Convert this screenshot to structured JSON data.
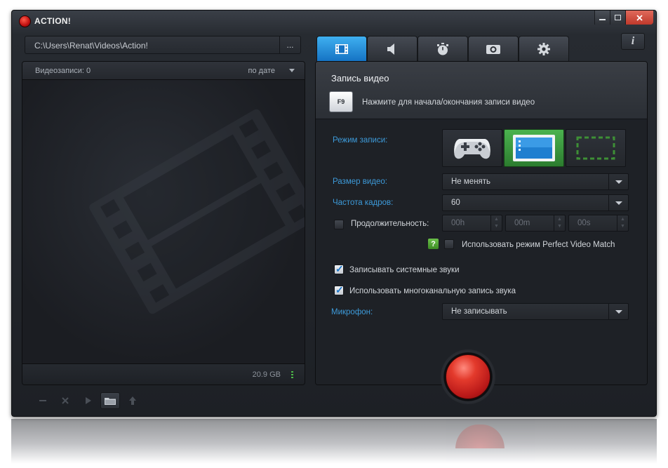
{
  "window": {
    "title": "ACTION!",
    "controls": [
      "minimize",
      "maximize",
      "close"
    ],
    "info_label": "i"
  },
  "path_bar": {
    "path": "C:\\Users\\Renat\\Videos\\Action!",
    "browse_label": "..."
  },
  "recordings": {
    "count_label": "Видеозаписи: 0",
    "sort_label": "по дате",
    "free_space": "20.9 GB"
  },
  "tabs": [
    {
      "name": "video",
      "icon": "film-icon",
      "active": true
    },
    {
      "name": "audio",
      "icon": "speaker-icon",
      "active": false
    },
    {
      "name": "timer",
      "icon": "stopwatch-icon",
      "active": false
    },
    {
      "name": "screenshot",
      "icon": "camera-icon",
      "active": false
    },
    {
      "name": "settings",
      "icon": "gear-icon",
      "active": false
    }
  ],
  "video_section": {
    "title": "Запись видео",
    "hotkey": "F9",
    "hotkey_hint": "Нажмите для начала/окончания записи видео"
  },
  "settings": {
    "mode_label": "Режим записи:",
    "modes": [
      {
        "name": "game",
        "icon": "gamepad-icon",
        "active": false
      },
      {
        "name": "desktop",
        "icon": "desktop-icon",
        "active": true
      },
      {
        "name": "region",
        "icon": "region-icon",
        "active": false
      }
    ],
    "size_label": "Размер видео:",
    "size_value": "Не менять",
    "fps_label": "Частота кадров:",
    "fps_value": "60",
    "duration_label": "Продолжительность:",
    "duration_checked": false,
    "duration_h": "00h",
    "duration_m": "00m",
    "duration_s": "00s",
    "help_label": "?",
    "pvm_label": "Использовать режим Perfect Video Match",
    "pvm_checked": false,
    "system_sounds_label": "Записывать системные звуки",
    "system_sounds_checked": true,
    "multichannel_label": "Использовать многоканальную запись звука",
    "multichannel_checked": true,
    "mic_label": "Микрофон:",
    "mic_value": "Не записывать"
  },
  "colors": {
    "accent_blue": "#3d9ad9",
    "active_tab": "#1e8ad8",
    "active_mode": "#3a9a3e",
    "record": "#e33a2c"
  }
}
